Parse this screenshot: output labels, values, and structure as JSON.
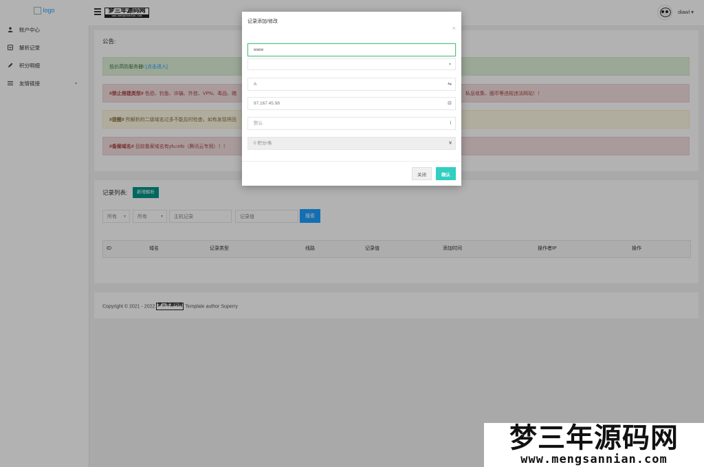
{
  "sidebar": {
    "logo_alt": "logo",
    "items": [
      {
        "label": "账户中心",
        "icon": "user-icon"
      },
      {
        "label": "解析记录",
        "icon": "record-icon"
      },
      {
        "label": "积分明细",
        "icon": "pencil-icon"
      },
      {
        "label": "友情链接",
        "icon": "list-icon",
        "has_submenu": true
      }
    ]
  },
  "header": {
    "brand_title": "梦三年源码网",
    "brand_url": "www.mengsannian.com",
    "username": "diawl"
  },
  "notice": {
    "title": "公告:",
    "alerts": [
      {
        "text": "低价高防服务器!",
        "link": "[点击进入]"
      },
      {
        "tag": "#禁止搭建类型#",
        "text": "色恐、钓鱼、诈骗、外挂、VPN、毒品、赌",
        "text_right": "私息收集、圈币等违规违法网站！！"
      },
      {
        "tag": "#提醒#",
        "text": "所解析的二级域名过多不能及时检查，如有发现将回"
      },
      {
        "tag": "#备案域名#",
        "text": "目前备案域名有yfu.info（腾讯云专用）！！"
      }
    ]
  },
  "records": {
    "title": "记录列表:",
    "add_button": "新增解析",
    "filter_type": "所有",
    "filter_line": "所有",
    "host_placeholder": "主机记录",
    "value_placeholder": "记录值",
    "search_button": "搜索",
    "columns": [
      "ID",
      "域名",
      "记录类型",
      "线路",
      "记录值",
      "添加时间",
      "操作者IP",
      "操作"
    ]
  },
  "footer": {
    "copyright": "Copyright © 2021 - 2022",
    "brand": "梦三年源码网",
    "author": "Template author Superry"
  },
  "modal": {
    "title": "记录添加/修改",
    "host_value": "www",
    "domain_value": "",
    "type_value": "A",
    "record_value": "97.167.45.98",
    "line_value": "默认",
    "cost_value": "0 积分/条",
    "cancel_label": "关闭",
    "ok_label": "确认"
  },
  "watermark": {
    "title": "梦三年源码网",
    "url": "www.mengsannian.com"
  }
}
